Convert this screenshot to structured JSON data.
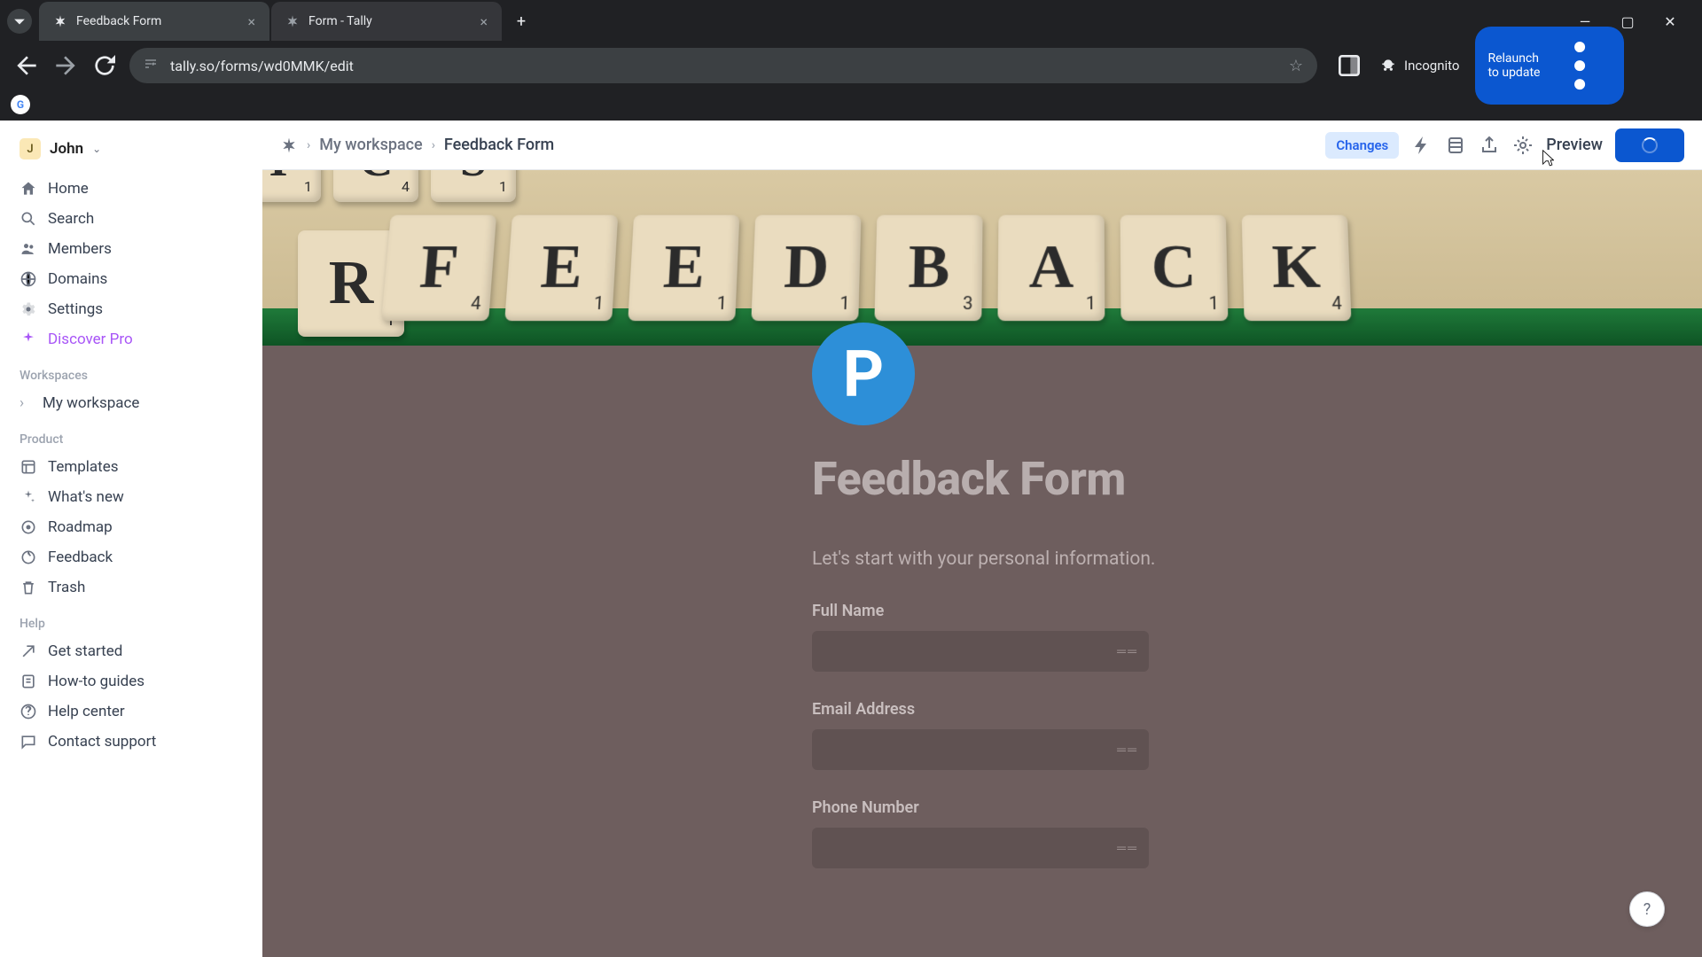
{
  "browser": {
    "tabs": [
      {
        "title": "Feedback Form",
        "active": true
      },
      {
        "title": "Form - Tally",
        "active": false
      }
    ],
    "url": "tally.so/forms/wd0MMK/edit",
    "incognito_label": "Incognito",
    "relaunch_label": "Relaunch to update"
  },
  "sidebar": {
    "user": {
      "initial": "J",
      "name": "John"
    },
    "nav": [
      {
        "icon": "home-icon",
        "label": "Home"
      },
      {
        "icon": "search-icon",
        "label": "Search"
      },
      {
        "icon": "members-icon",
        "label": "Members"
      },
      {
        "icon": "domains-icon",
        "label": "Domains"
      },
      {
        "icon": "settings-icon",
        "label": "Settings"
      },
      {
        "icon": "sparkle-icon",
        "label": "Discover Pro",
        "pro": true
      }
    ],
    "sections": {
      "workspaces_label": "Workspaces",
      "workspaces": [
        {
          "label": "My workspace"
        }
      ],
      "product_label": "Product",
      "product": [
        {
          "icon": "templates-icon",
          "label": "Templates"
        },
        {
          "icon": "sparkle-icon",
          "label": "What's new"
        },
        {
          "icon": "roadmap-icon",
          "label": "Roadmap"
        },
        {
          "icon": "feedback-icon",
          "label": "Feedback"
        },
        {
          "icon": "trash-icon",
          "label": "Trash"
        }
      ],
      "help_label": "Help",
      "help": [
        {
          "icon": "arrow-icon",
          "label": "Get started"
        },
        {
          "icon": "guides-icon",
          "label": "How-to guides"
        },
        {
          "icon": "help-icon",
          "label": "Help center"
        },
        {
          "icon": "chat-icon",
          "label": "Contact support"
        }
      ]
    }
  },
  "topbar": {
    "breadcrumb": [
      "My workspace",
      "Feedback Form"
    ],
    "changes_label": "Changes",
    "preview_label": "Preview"
  },
  "cover": {
    "tiles_top": [
      {
        "letter": "I",
        "sub": "1"
      },
      {
        "letter": "C",
        "sub": "4"
      },
      {
        "letter": "S",
        "sub": "1"
      }
    ],
    "tiles_main": [
      {
        "letter": "F",
        "sub": "4"
      },
      {
        "letter": "E",
        "sub": "1"
      },
      {
        "letter": "E",
        "sub": "1"
      },
      {
        "letter": "D",
        "sub": "1"
      },
      {
        "letter": "B",
        "sub": "3"
      },
      {
        "letter": "A",
        "sub": "1"
      },
      {
        "letter": "C",
        "sub": "1"
      },
      {
        "letter": "K",
        "sub": "4"
      }
    ],
    "rack_lead": {
      "letter": "R",
      "sub": "1"
    }
  },
  "form": {
    "logo_letter": "P",
    "title": "Feedback Form",
    "description": "Let's start with your personal information.",
    "fields": [
      {
        "label": "Full Name"
      },
      {
        "label": "Email Address"
      },
      {
        "label": "Phone Number"
      }
    ]
  },
  "help_fab": "?"
}
